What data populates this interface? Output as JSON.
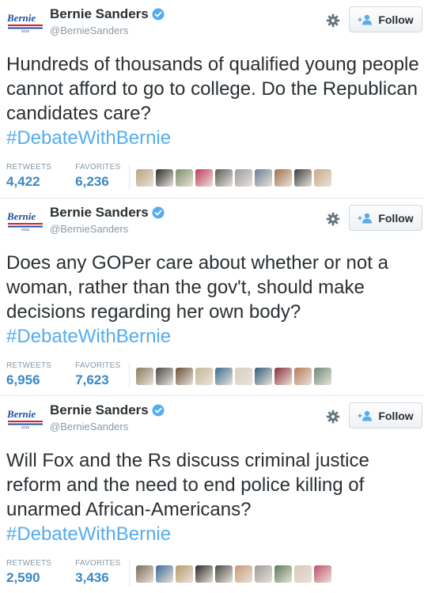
{
  "account": {
    "logo_text": "Bernie",
    "logo_year": "2016",
    "display_name": "Bernie Sanders",
    "screen_name": "@BernieSanders",
    "follow_label": "Follow"
  },
  "labels": {
    "retweets": "RETWEETS",
    "favorites": "FAVORITES"
  },
  "colors": {
    "accent": "#55acee",
    "count": "#3b88c3",
    "logo_blue": "#1f4fa3",
    "logo_red": "#d6202a"
  },
  "tweets": [
    {
      "text": "Hundreds of thousands of qualified young people cannot afford to go to college. Do the Republican candidates care?",
      "hashtag": "#DebateWithBernie",
      "retweets": "4,422",
      "favorites": "6,236",
      "avatars": [
        "#b9a27c",
        "#2c2c2c",
        "#7d8f6a",
        "#c23b5a",
        "#5a5a5a",
        "#9c9c9c",
        "#6a7f9a",
        "#a0704e",
        "#3d3d3d",
        "#c9a88a"
      ]
    },
    {
      "text": "Does any GOPer care about whether or not a woman, rather than the gov't, should make decisions regarding her own body?",
      "hashtag": "#DebateWithBernie",
      "retweets": "6,956",
      "favorites": "7,623",
      "avatars": [
        "#8a7a5c",
        "#4a4a4a",
        "#6b4f3a",
        "#c8b89a",
        "#3b6e8f",
        "#d8d0c0",
        "#2f5f7a",
        "#8c2f3a",
        "#b87a5a",
        "#6a8a7a"
      ]
    },
    {
      "text": "Will Fox and the Rs discuss criminal justice reform and the need to end police killing of unarmed African-Americans?",
      "hashtag": "#DebateWithBernie",
      "retweets": "2,590",
      "favorites": "3,436",
      "avatars": [
        "#7a6a5a",
        "#3a6a9a",
        "#b89a6a",
        "#2a2a2a",
        "#4a4a4a",
        "#c89a7a",
        "#9a9a9a",
        "#5a7a5a",
        "#d8c8b8",
        "#c0506a"
      ]
    }
  ]
}
